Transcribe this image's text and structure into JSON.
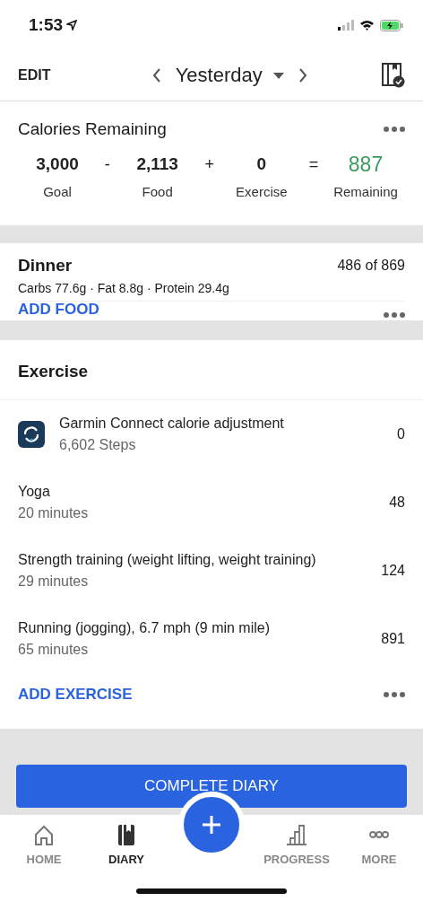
{
  "status_bar": {
    "time": "1:53"
  },
  "header": {
    "edit": "EDIT",
    "date": "Yesterday"
  },
  "calories": {
    "title": "Calories Remaining",
    "terms": [
      {
        "value": "3,000",
        "label": "Goal",
        "op": "-",
        "highlight": false
      },
      {
        "value": "2,113",
        "label": "Food",
        "op": "+",
        "highlight": false
      },
      {
        "value": "0",
        "label": "Exercise",
        "op": "=",
        "highlight": false
      },
      {
        "value": "887",
        "label": "Remaining",
        "highlight": true
      }
    ]
  },
  "dinner": {
    "title": "Dinner",
    "total": "486 of 869",
    "macros": "Carbs 77.6g · Fat 8.8g · Protein 29.4g",
    "add": "ADD FOOD"
  },
  "exercise": {
    "title": "Exercise",
    "items": [
      {
        "kind": "device",
        "name": "Garmin Connect calorie adjustment",
        "detail": "6,602 Steps",
        "calories": "0"
      },
      {
        "kind": "plain",
        "name": "Yoga",
        "detail": "20 minutes",
        "calories": "48"
      },
      {
        "kind": "plain",
        "name": "Strength training (weight lifting, weight training)",
        "detail": "29 minutes",
        "calories": "124"
      },
      {
        "kind": "plain",
        "name": "Running (jogging), 6.7 mph (9 min mile)",
        "detail": "65 minutes",
        "calories": "891"
      }
    ],
    "add": "ADD EXERCISE"
  },
  "complete_button": "COMPLETE DIARY",
  "tabs": [
    {
      "label": "HOME",
      "kind": "home",
      "selected": false
    },
    {
      "label": "DIARY",
      "kind": "diary",
      "selected": true
    },
    {
      "label": "PROGRESS",
      "kind": "progress",
      "selected": false
    },
    {
      "label": "MORE",
      "kind": "more",
      "selected": false
    }
  ]
}
